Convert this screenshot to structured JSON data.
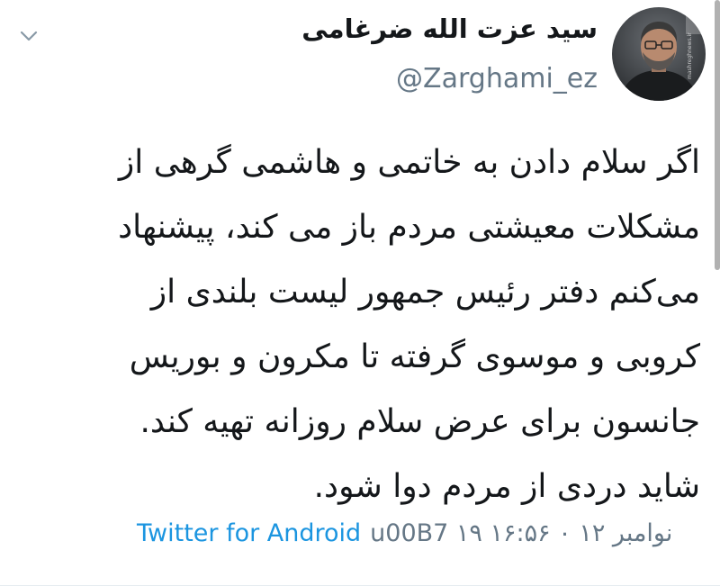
{
  "tweet": {
    "author": {
      "display_name": "سید عزت الله ضرغامی",
      "handle": "@Zarghami_ez",
      "avatar_watermark": "mashreghnews.ir"
    },
    "text_lines": [
      "اگر سلام دادن به خاتمی و هاشمی گرهی از",
      "مشکلات معیشتی مردم باز می کند، پیشنهاد",
      "می‌کنم دفتر رئیس جمهور لیست بلندی از",
      "کروبی و موسوی گرفته تا مکرون و بوریس",
      "جانسون برای عرض سلام روزانه تهیه کند.",
      "شاید دردی از مردم دوا شود."
    ],
    "source": "Twitter for Android",
    "timestamp": "u00B7 ۱۹ نوامبر ۱۲ ۰ ۱۶:۵۶",
    "icons": {
      "menu": "chevron-down-icon",
      "avatar": "avatar"
    },
    "colors": {
      "link": "#1b95e0",
      "secondary": "#657786",
      "text": "#14171a"
    }
  }
}
